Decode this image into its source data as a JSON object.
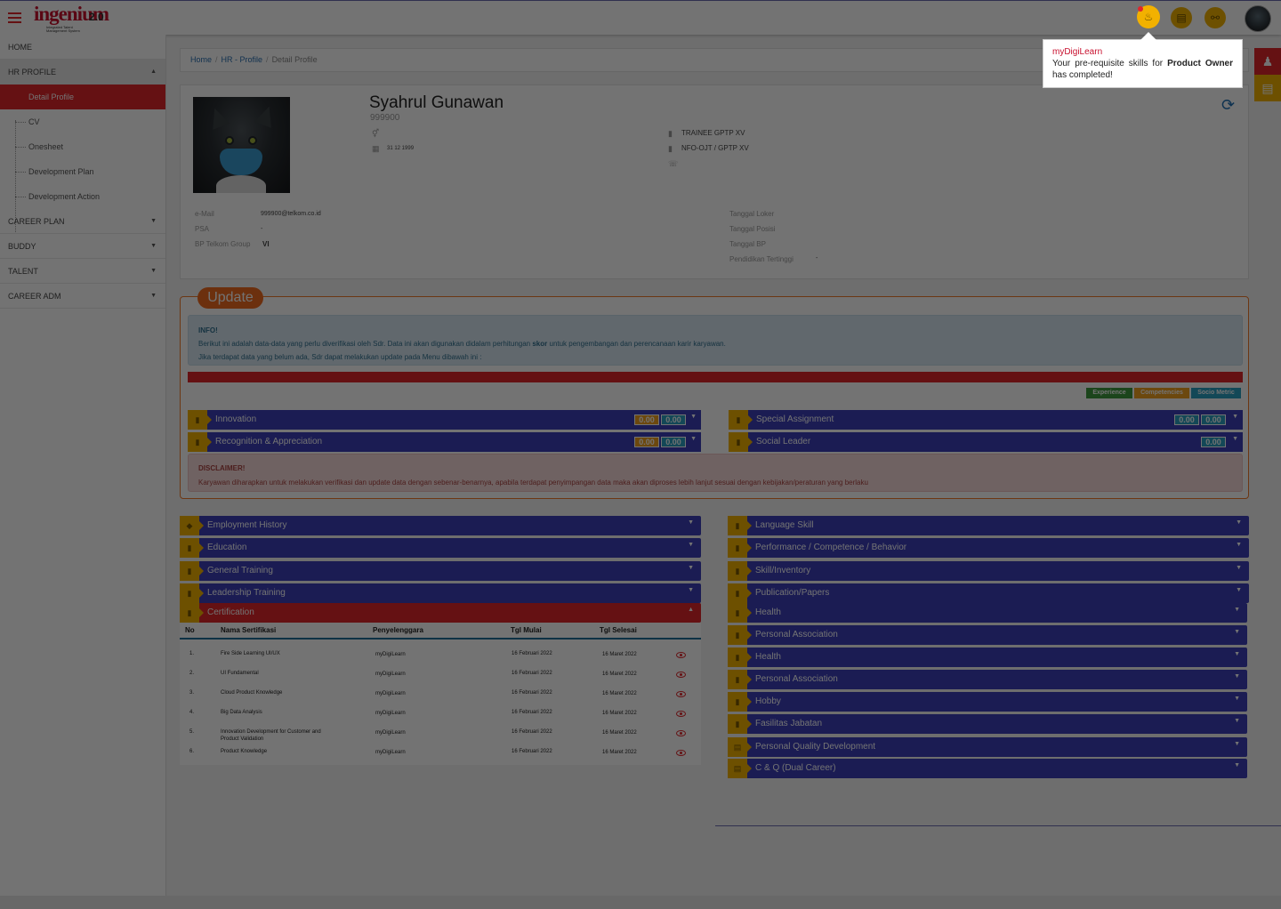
{
  "app": {
    "logo_text": "ingenium",
    "version": "2.0",
    "tagline": "Integrated Talent Management System"
  },
  "header": {
    "icons": [
      "bell-icon",
      "document-icon",
      "share-icon"
    ]
  },
  "sidebar": {
    "items": [
      {
        "label": "HOME"
      },
      {
        "label": "HR PROFILE",
        "caret": "▲"
      },
      {
        "label": "CAREER PLAN",
        "caret": "▼"
      },
      {
        "label": "BUDDY",
        "caret": "▼"
      },
      {
        "label": "TALENT",
        "caret": "▼"
      },
      {
        "label": "CAREER ADM",
        "caret": "▼"
      }
    ],
    "sub_items": [
      {
        "label": "Detail Profile"
      },
      {
        "label": "CV"
      },
      {
        "label": "Onesheet"
      },
      {
        "label": "Development Plan"
      },
      {
        "label": "Development Action"
      }
    ]
  },
  "breadcrumb": {
    "home": "Home",
    "hr_profile": "HR - Profile",
    "current": "Detail Profile",
    "sep": "/"
  },
  "profile": {
    "name": "Syahrul Gunawan",
    "nik": "999900",
    "birth_date": "31 12 1999",
    "position": "TRAINEE GPTP XV",
    "unit": "NFO-OJT / GPTP XV",
    "email_label": "e-Mail",
    "email": "999900@telkom.co.id",
    "psa_label": "PSA",
    "psa": "-",
    "bp_label": "BP Telkom Group",
    "bp": "VI",
    "tanggal_loker_label": "Tanggal Loker",
    "tanggal_posisi_label": "Tanggal Posisi",
    "tanggal_bp_label": "Tanggal BP",
    "pendidikan_label": "Pendidikan Tertinggi",
    "pendidikan": "-"
  },
  "update": {
    "badge": "Update",
    "info_title": "INFO!",
    "info_line1_a": "Berikut ini adalah data-data yang perlu diverifikasi oleh Sdr. Data ini akan digunakan didalam perhitungan ",
    "info_line1_b": "skor",
    "info_line1_c": " untuk pengembangan dan perencanaan karir karyawan.",
    "info_line2": "Jika terdapat data yang belum ada, Sdr dapat melakukan update pada Menu dibawah ini :",
    "legend": [
      "Experience",
      "Competencies",
      "Socio Metric"
    ],
    "legend_colors": [
      "#3f9a3f",
      "#f0a020",
      "#2b9fc0"
    ],
    "metrics_left": [
      {
        "title": "Innovation",
        "scores": [
          "0.00",
          "0.00"
        ]
      },
      {
        "title": "Recognition & Appreciation",
        "scores": [
          "0.00",
          "0.00"
        ]
      }
    ],
    "metrics_right": [
      {
        "title": "Special Assignment",
        "scores": [
          "0.00",
          "0.00"
        ]
      },
      {
        "title": "Social Leader",
        "scores": [
          "0.00"
        ]
      }
    ],
    "disclaimer_title": "DISCLAIMER!",
    "disclaimer_text": "Karyawan diharapkan untuk melakukan verifikasi dan update data dengan sebenar-benarnya, apabila terdapat penyimpangan data maka akan diproses lebih lanjut sesuai dengan kebijakan/peraturan yang berlaku"
  },
  "sections_left": [
    {
      "title": "Employment History"
    },
    {
      "title": "Education"
    },
    {
      "title": "General Training"
    },
    {
      "title": "Leadership Training"
    },
    {
      "title": "Certification"
    }
  ],
  "sections_right": [
    {
      "title": "Language Skill"
    },
    {
      "title": "Performance / Competence / Behavior"
    },
    {
      "title": "Skill/Inventory"
    },
    {
      "title": "Publication/Papers"
    },
    {
      "title": "Health"
    },
    {
      "title": "Personal Association"
    },
    {
      "title": "Health"
    },
    {
      "title": "Personal Association"
    },
    {
      "title": "Hobby"
    },
    {
      "title": "Fasilitas Jabatan"
    },
    {
      "title": "Personal Quality Development"
    },
    {
      "title": "C & Q (Dual Career)"
    }
  ],
  "certification": {
    "headers": [
      "No",
      "Nama Sertifikasi",
      "Penyelenggara",
      "Tgl Mulai",
      "Tgl Selesai"
    ],
    "rows": [
      [
        "1.",
        "Fire Side Learning UI/UX",
        "myDigiLearn",
        "16 Februari 2022",
        "16 Maret 2022"
      ],
      [
        "2.",
        "UI Fundamental",
        "myDigiLearn",
        "16 Februari 2022",
        "16 Maret 2022"
      ],
      [
        "3.",
        "Cloud Product Knowledge",
        "myDigiLearn",
        "16 Februari 2022",
        "16 Maret 2022"
      ],
      [
        "4.",
        "Big Data Analysis",
        "myDigiLearn",
        "16 Februari 2022",
        "16 Maret 2022"
      ],
      [
        "5.",
        "Innovation Development for Customer and Product Validation",
        "myDigiLearn",
        "16 Februari 2022",
        "16 Maret 2022"
      ],
      [
        "6.",
        "Product Knowledge",
        "myDigiLearn",
        "16 Februari 2022",
        "16 Maret 2022"
      ]
    ]
  },
  "notification": {
    "title": "myDigiLearn",
    "text_a": "Your pre-requisite skills for ",
    "text_b": "Product Owner",
    "text_c": " has completed!"
  },
  "colors": {
    "primary": "#3c3fb8",
    "accent": "#e0262b",
    "tag": "#f2b100",
    "update": "#ef6a1f"
  }
}
